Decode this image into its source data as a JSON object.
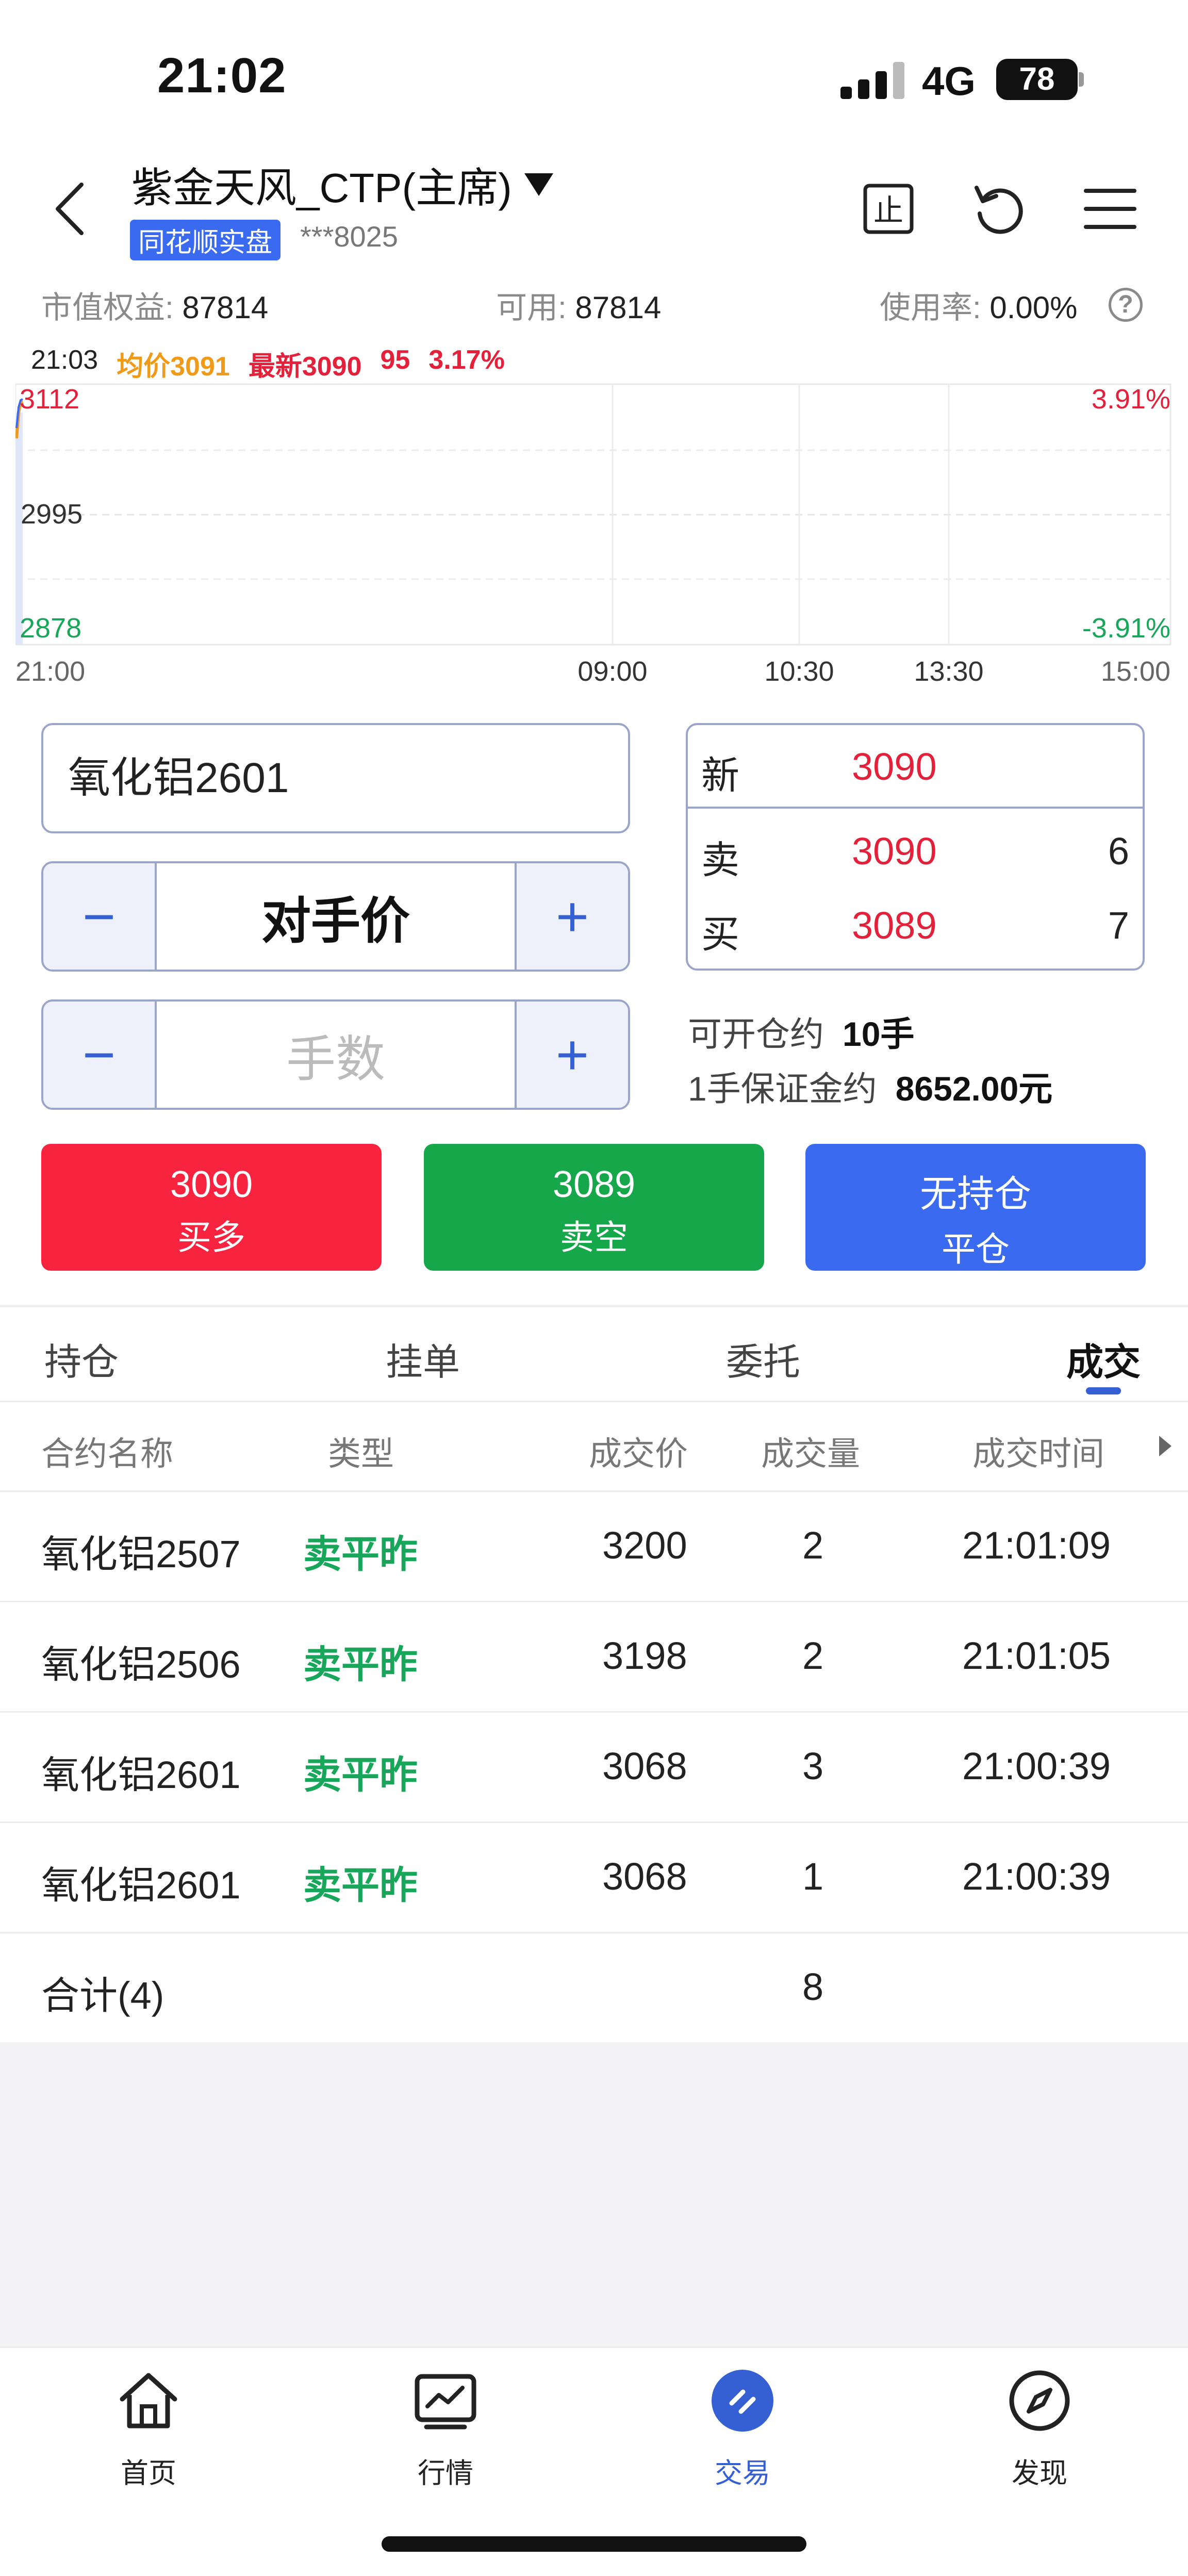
{
  "status_bar": {
    "time": "21:02",
    "network": "4G",
    "battery": "78"
  },
  "header": {
    "account_name": "紫金天风_CTP(主席)",
    "badge": "同花顺实盘",
    "account_no": "***8025",
    "icons": [
      "stop-icon",
      "refresh-icon",
      "menu-icon"
    ]
  },
  "metrics": {
    "equity_label": "市值权益:",
    "equity_value": "87814",
    "available_label": "可用:",
    "available_value": "87814",
    "usage_label": "使用率:",
    "usage_value": "0.00%",
    "help": "?"
  },
  "chart": {
    "time": "21:03",
    "avg_text": "均价3091",
    "latest_text": "最新3090",
    "change": "95",
    "change_pct": "3.17%",
    "y_high": "3112",
    "y_mid": "2995",
    "y_low": "2878",
    "pct_high": "3.91%",
    "pct_low": "-3.91%",
    "x_ticks": [
      "21:00",
      "09:00",
      "10:30",
      "13:30",
      "15:00"
    ],
    "colors": {
      "up": "#e3213a",
      "down": "#18a75a",
      "avg": "#f09a1a"
    }
  },
  "order_form": {
    "contract": "氧化铝2601",
    "price_mode": "对手价",
    "qty_placeholder": "手数",
    "minus": "−",
    "plus": "+"
  },
  "quote": {
    "new_label": "新",
    "new_price": "3090",
    "ask_label": "卖",
    "ask_price": "3090",
    "ask_vol": "6",
    "bid_label": "买",
    "bid_price": "3089",
    "bid_vol": "7"
  },
  "info": {
    "open_label": "可开仓约",
    "open_value": "10手",
    "margin_label": "1手保证金约",
    "margin_value": "8652.00元"
  },
  "actions": {
    "buy_price": "3090",
    "buy_label": "买多",
    "sell_price": "3089",
    "sell_label": "卖空",
    "close_status": "无持仓",
    "close_label": "平仓",
    "colors": {
      "buy": "#f7233f",
      "sell": "#16a74b",
      "close": "#3a6af0"
    }
  },
  "tabs": [
    "持仓",
    "挂单",
    "委托",
    "成交"
  ],
  "table": {
    "headers": [
      "合约名称",
      "类型",
      "成交价",
      "成交量",
      "成交时间"
    ],
    "rows": [
      {
        "name": "氧化铝2507",
        "type": "卖平昨",
        "price": "3200",
        "qty": "2",
        "time": "21:01:09"
      },
      {
        "name": "氧化铝2506",
        "type": "卖平昨",
        "price": "3198",
        "qty": "2",
        "time": "21:01:05"
      },
      {
        "name": "氧化铝2601",
        "type": "卖平昨",
        "price": "3068",
        "qty": "3",
        "time": "21:00:39"
      },
      {
        "name": "氧化铝2601",
        "type": "卖平昨",
        "price": "3068",
        "qty": "1",
        "time": "21:00:39"
      }
    ],
    "total_label": "合计(4)",
    "total_qty": "8"
  },
  "nav": [
    {
      "label": "首页",
      "icon": "home-icon"
    },
    {
      "label": "行情",
      "icon": "chart-icon"
    },
    {
      "label": "交易",
      "icon": "trade-icon"
    },
    {
      "label": "发现",
      "icon": "compass-icon"
    }
  ]
}
